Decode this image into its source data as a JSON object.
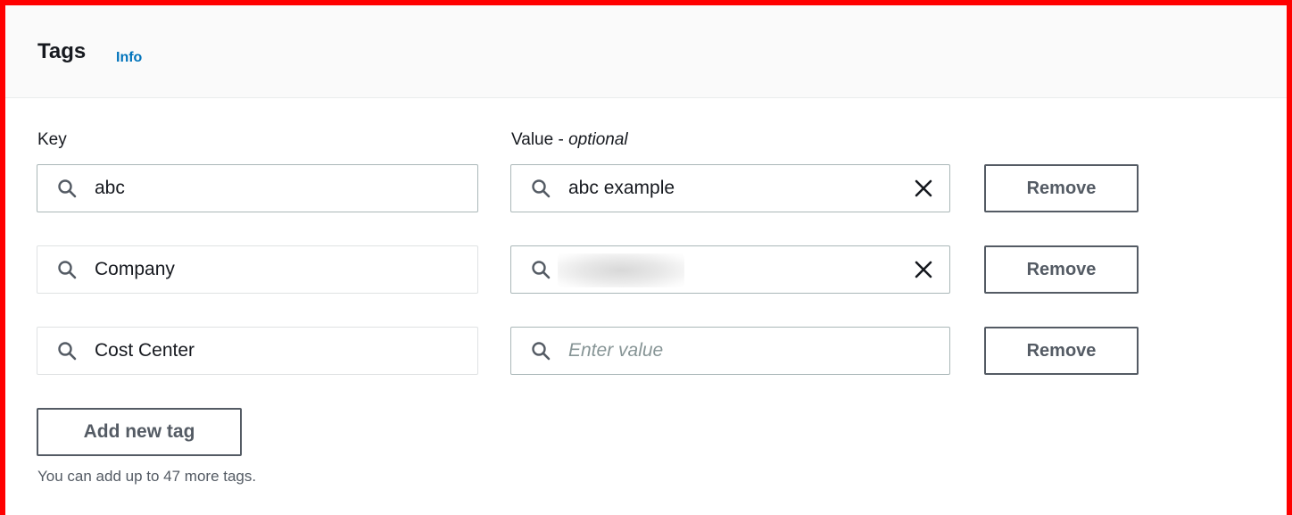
{
  "panel": {
    "title": "Tags",
    "info_link": "Info"
  },
  "columns": {
    "key_label": "Key",
    "value_label_main": "Value - ",
    "value_label_suffix": "optional"
  },
  "rows": [
    {
      "key": "abc",
      "value": "abc example",
      "value_placeholder": "",
      "value_redacted": false,
      "show_clear": true,
      "remove_label": "Remove"
    },
    {
      "key": "Company",
      "value": "",
      "value_placeholder": "",
      "value_redacted": true,
      "show_clear": true,
      "remove_label": "Remove"
    },
    {
      "key": "Cost Center",
      "value": "",
      "value_placeholder": "Enter value",
      "value_redacted": false,
      "show_clear": false,
      "remove_label": "Remove"
    }
  ],
  "add_button_label": "Add new tag",
  "help_text": "You can add up to 47 more tags.",
  "colors": {
    "frame": "#ff0000",
    "link": "#0073bb",
    "button_border": "#545b64",
    "header_bg": "#fafafa"
  },
  "icons": [
    "search-icon",
    "close-icon"
  ]
}
